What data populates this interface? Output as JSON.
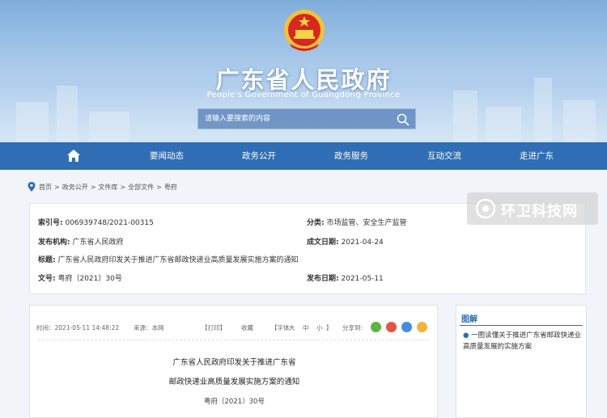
{
  "header": {
    "title": "广东省人民政府",
    "subtitle": "People's Government of Guangdong Province",
    "search_placeholder": "请输入要搜索的内容"
  },
  "nav": {
    "items": [
      "要闻动态",
      "政务公开",
      "政务服务",
      "互动交流",
      "走进广东"
    ]
  },
  "breadcrumb": [
    "首页",
    "政务公开",
    "文件库",
    "全部文件",
    "粤府"
  ],
  "info": {
    "index_label": "索引号:",
    "index_value": "006939748/2021-00315",
    "category_label": "分类:",
    "category_value": "市场监管、安全生产监管",
    "publisher_label": "发布机构:",
    "publisher_value": "广东省人民政府",
    "created_label": "成文日期:",
    "created_value": "2021-04-24",
    "title_label": "标题:",
    "title_value": "广东省人民政府印发关于推进广东省邮政快递业高质量发展实施方案的通知",
    "docno_label": "文号:",
    "docno_value": "粤府〔2021〕30号",
    "published_label": "发布日期:",
    "published_value": "2021-05-11"
  },
  "watermark": {
    "text": "环卫科技网"
  },
  "article": {
    "time": "时间：2021-05-11 14:48:22",
    "source": "来源：本网",
    "print": "【打印】",
    "collect": "收藏",
    "font_size_label": "【字体:",
    "font_large": "大",
    "font_medium": "中",
    "font_small": "小",
    "font_close": "】",
    "share_label": "分享到:",
    "title_line1": "广东省人民政府印发关于推进广东省",
    "title_line2": "邮政快递业高质量发展实施方案的通知",
    "doc_number": "粤府〔2021〕30号"
  },
  "sidebar": {
    "heading": "图解",
    "item": "一图读懂关于推进广东省邮政快递业高质量发展的实施方案"
  },
  "colors": {
    "nav": "#2f6db5",
    "banner_top": "#7faedb",
    "share_wechat": "#5ab643",
    "share_weibo": "#e8543f",
    "share_qq": "#3f8ee0",
    "share_other": "#f2b43a"
  }
}
